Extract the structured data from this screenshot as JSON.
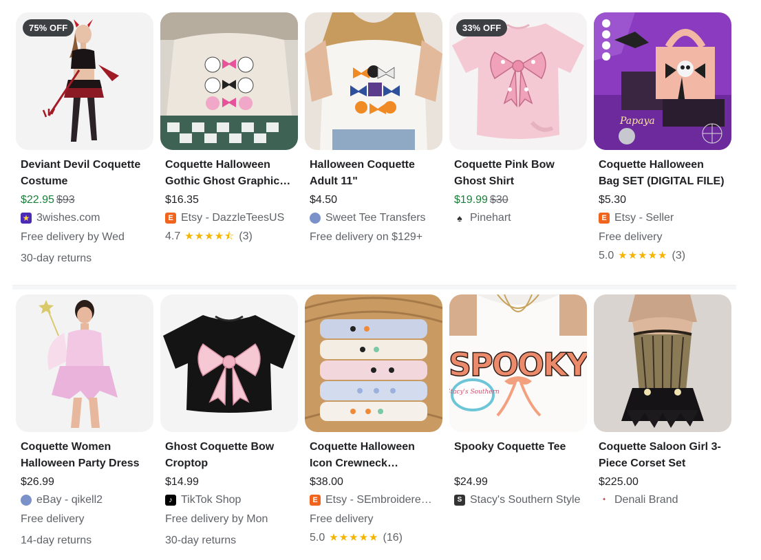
{
  "products": [
    {
      "title": "Deviant Devil Coquette Costume",
      "badge": "75% OFF",
      "price": "$22.95",
      "was_price": "$93",
      "seller": "3wishes.com",
      "delivery": "Free delivery by Wed",
      "returns": "30-day returns"
    },
    {
      "title": "Coquette Halloween Gothic Ghost Graphic Tee",
      "price": "$16.35",
      "seller": "Etsy - DazzleTeesUS",
      "rating": "4.7",
      "stars": "★★★★⯪",
      "reviews": "(3)"
    },
    {
      "title": "Halloween Coquette Adult 11\"",
      "price": "$4.50",
      "seller": "Sweet Tee Transfers",
      "delivery": "Free delivery on $129+"
    },
    {
      "title": "Coquette Pink Bow Ghost Shirt",
      "badge": "33% OFF",
      "price": "$19.99",
      "was_price": "$30",
      "seller": "Pinehart"
    },
    {
      "title": "Coquette Halloween Bag SET (DIGITAL FILE)",
      "price": "$5.30",
      "seller": "Etsy - Seller",
      "delivery": "Free delivery",
      "rating": "5.0",
      "stars": "★★★★★",
      "reviews": "(3)"
    },
    {
      "title": "Coquette Women Halloween Party Dress",
      "price": "$26.99",
      "seller": "eBay - qikell2",
      "delivery": "Free delivery",
      "returns": "14-day returns"
    },
    {
      "title": "Ghost Coquette Bow Croptop",
      "price": "$14.99",
      "seller": "TikTok Shop",
      "delivery": "Free delivery by Mon",
      "returns": "30-day returns"
    },
    {
      "title": "Coquette Halloween Icon Crewneck Sweatshirt",
      "price": "$38.00",
      "seller": "Etsy - SEmbroidereDesigns",
      "delivery": "Free delivery",
      "rating": "5.0",
      "stars": "★★★★★",
      "reviews": "(16)"
    },
    {
      "title": "Spooky Coquette Tee",
      "price": "$24.99",
      "seller": "Stacy's Southern Style"
    },
    {
      "title": "Coquette Saloon Girl 3-Piece Corset Set",
      "price": "$225.00",
      "seller": "Denali Brand"
    }
  ],
  "image_texts": {
    "papaya_logo": "Papaya",
    "spooky_word": "SPOOKY",
    "stacys_logo": "Stacy's Southern"
  },
  "colors": {
    "sale_green": "#188038",
    "star_yellow": "#f4b400",
    "etsy_orange": "#f1641e"
  }
}
